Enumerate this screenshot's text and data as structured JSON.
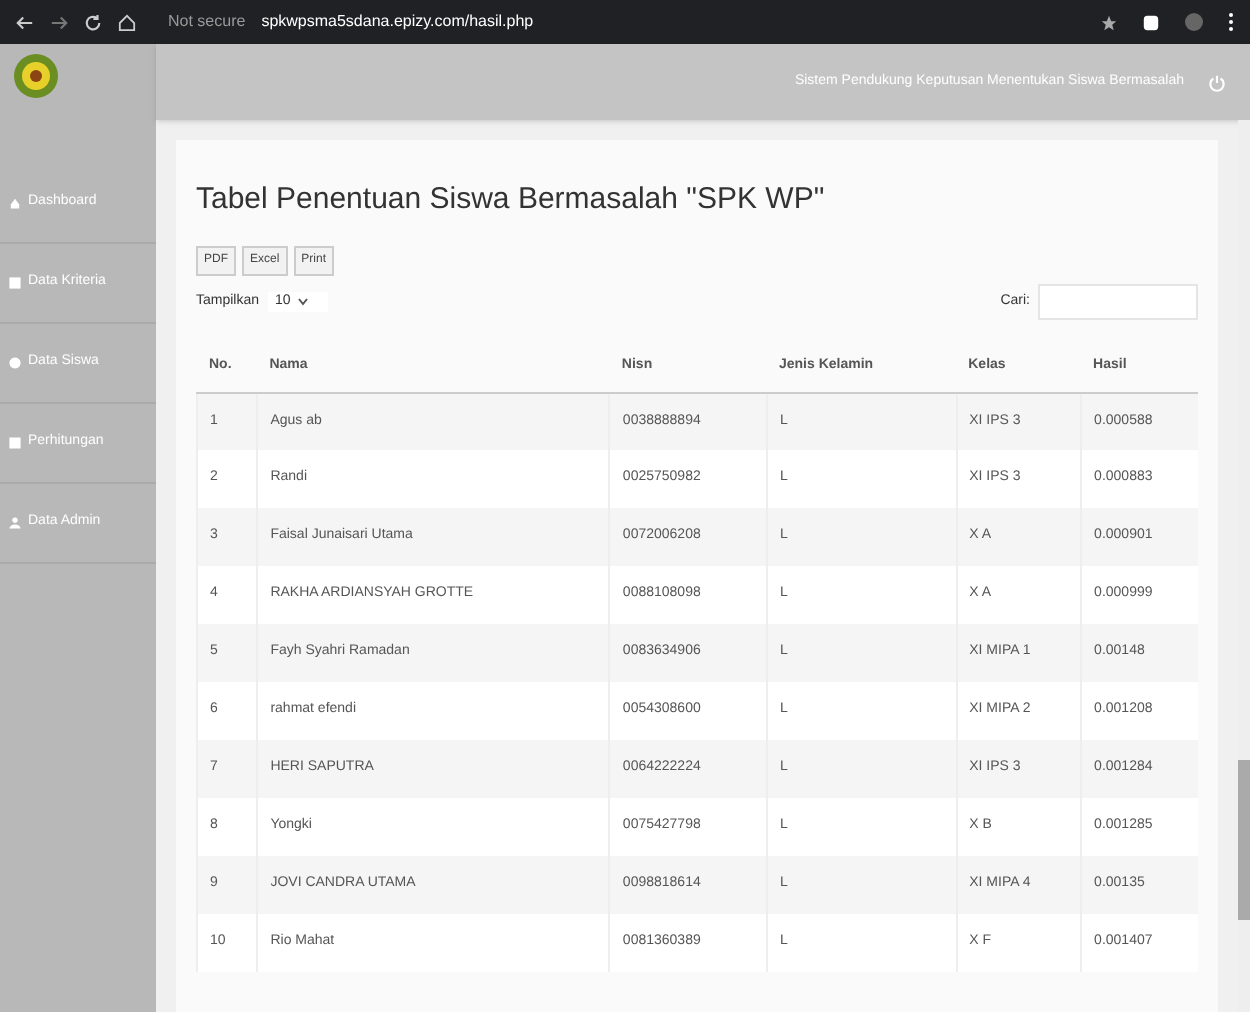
{
  "browser": {
    "security": "Not secure",
    "url": "spkwpsma5sdana.epizy.com/hasil.php"
  },
  "header": {
    "title": "Sistem Pendukung Keputusan Menentukan Siswa Bermasalah"
  },
  "sidebar": {
    "items": [
      {
        "label": "Dashboard"
      },
      {
        "label": "Data Kriteria"
      },
      {
        "label": "Data Siswa"
      },
      {
        "label": "Perhitungan"
      },
      {
        "label": "Data Admin"
      }
    ]
  },
  "page_title": "Tabel Penentuan Siswa Bermasalah \"SPK WP\"",
  "export_buttons": [
    "PDF",
    "Excel",
    "Print"
  ],
  "length": {
    "label": "Tampilkan",
    "value": "10"
  },
  "search": {
    "label": "Cari:"
  },
  "table": {
    "columns": [
      "No.",
      "Nama",
      "Nisn",
      "Jenis Kelamin",
      "Kelas",
      "Hasil"
    ],
    "rows": [
      [
        "1",
        "Agus ab",
        "0038888894",
        "L",
        "XI IPS 3",
        "0.000588"
      ],
      [
        "2",
        "Randi",
        "0025750982",
        "L",
        "XI IPS 3",
        "0.000883"
      ],
      [
        "3",
        "Faisal Junaisari Utama",
        "0072006208",
        "L",
        "X A",
        "0.000901"
      ],
      [
        "4",
        "RAKHA ARDIANSYAH GROTTE",
        "0088108098",
        "L",
        "X A",
        "0.000999"
      ],
      [
        "5",
        "Fayh Syahri Ramadan",
        "0083634906",
        "L",
        "XI MIPA 1",
        "0.00148"
      ],
      [
        "6",
        "rahmat efendi",
        "0054308600",
        "L",
        "XI MIPA 2",
        "0.001208"
      ],
      [
        "7",
        "HERI SAPUTRA",
        "0064222224",
        "L",
        "XI IPS 3",
        "0.001284"
      ],
      [
        "8",
        "Yongki",
        "0075427798",
        "L",
        "X B",
        "0.001285"
      ],
      [
        "9",
        "JOVI CANDRA UTAMA",
        "0098818614",
        "L",
        "XI MIPA 4",
        "0.00135"
      ],
      [
        "10",
        "Rio Mahat",
        "0081360389",
        "L",
        "X F",
        "0.001407"
      ]
    ]
  }
}
